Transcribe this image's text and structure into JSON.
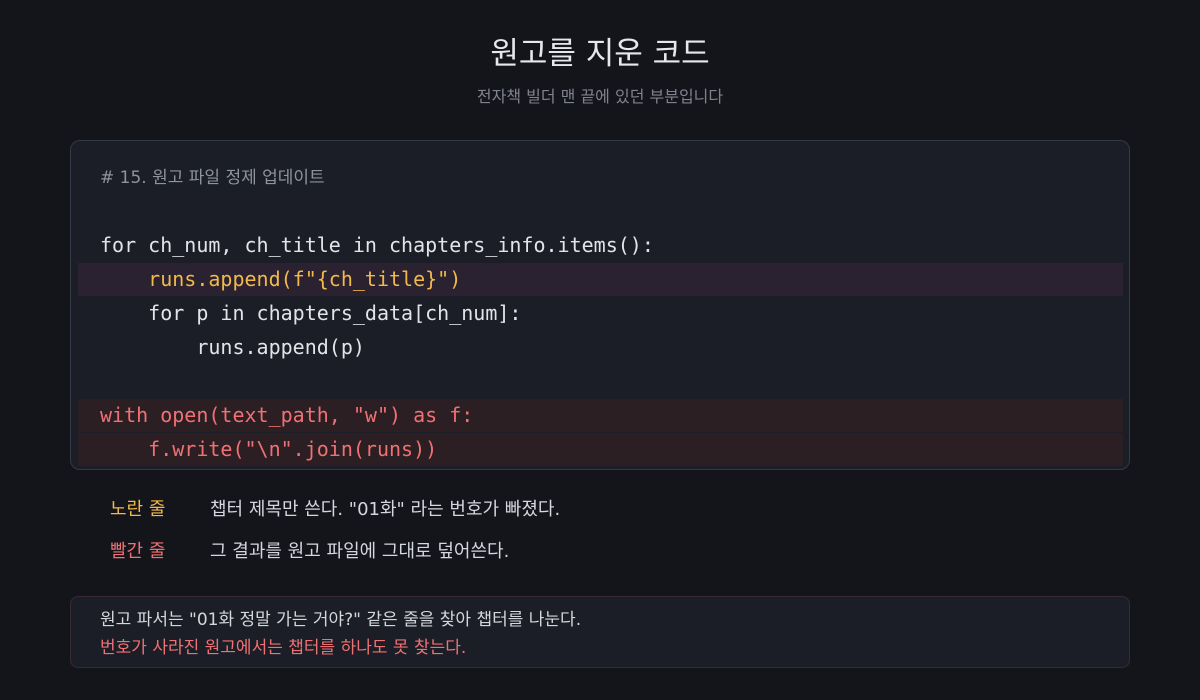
{
  "header": {
    "title": "원고를 지운 코드",
    "subtitle": "전자책 빌더 맨 끝에 있던 부분입니다"
  },
  "code": {
    "comment": "# 15. 원고 파일 정제 업데이트",
    "lines": [
      "for ch_num, ch_title in chapters_info.items():",
      "    runs.append(f\"{ch_title}\")",
      "    for p in chapters_data[ch_num]:",
      "        runs.append(p)",
      "",
      "with open(text_path, \"w\") as f:",
      "    f.write(\"\\n\".join(runs))"
    ]
  },
  "legend": {
    "yellow_label": "노란 줄",
    "yellow_text": "챕터 제목만 쓴다. \"01화\" 라는 번호가 빠졌다.",
    "red_label": "빨간 줄",
    "red_text": "그 결과를 원고 파일에 그대로 덮어쓴다."
  },
  "note": {
    "line1": "원고 파서는 \"01화 정말 가는 거야?\" 같은 줄을 찾아 챕터를 나눈다.",
    "line2": "번호가 사라진 원고에서는 챕터를 하나도 못 찾는다."
  },
  "colors": {
    "background": "#14151a",
    "yellow_accent": "#f2b94a",
    "red_accent": "#f07174"
  }
}
